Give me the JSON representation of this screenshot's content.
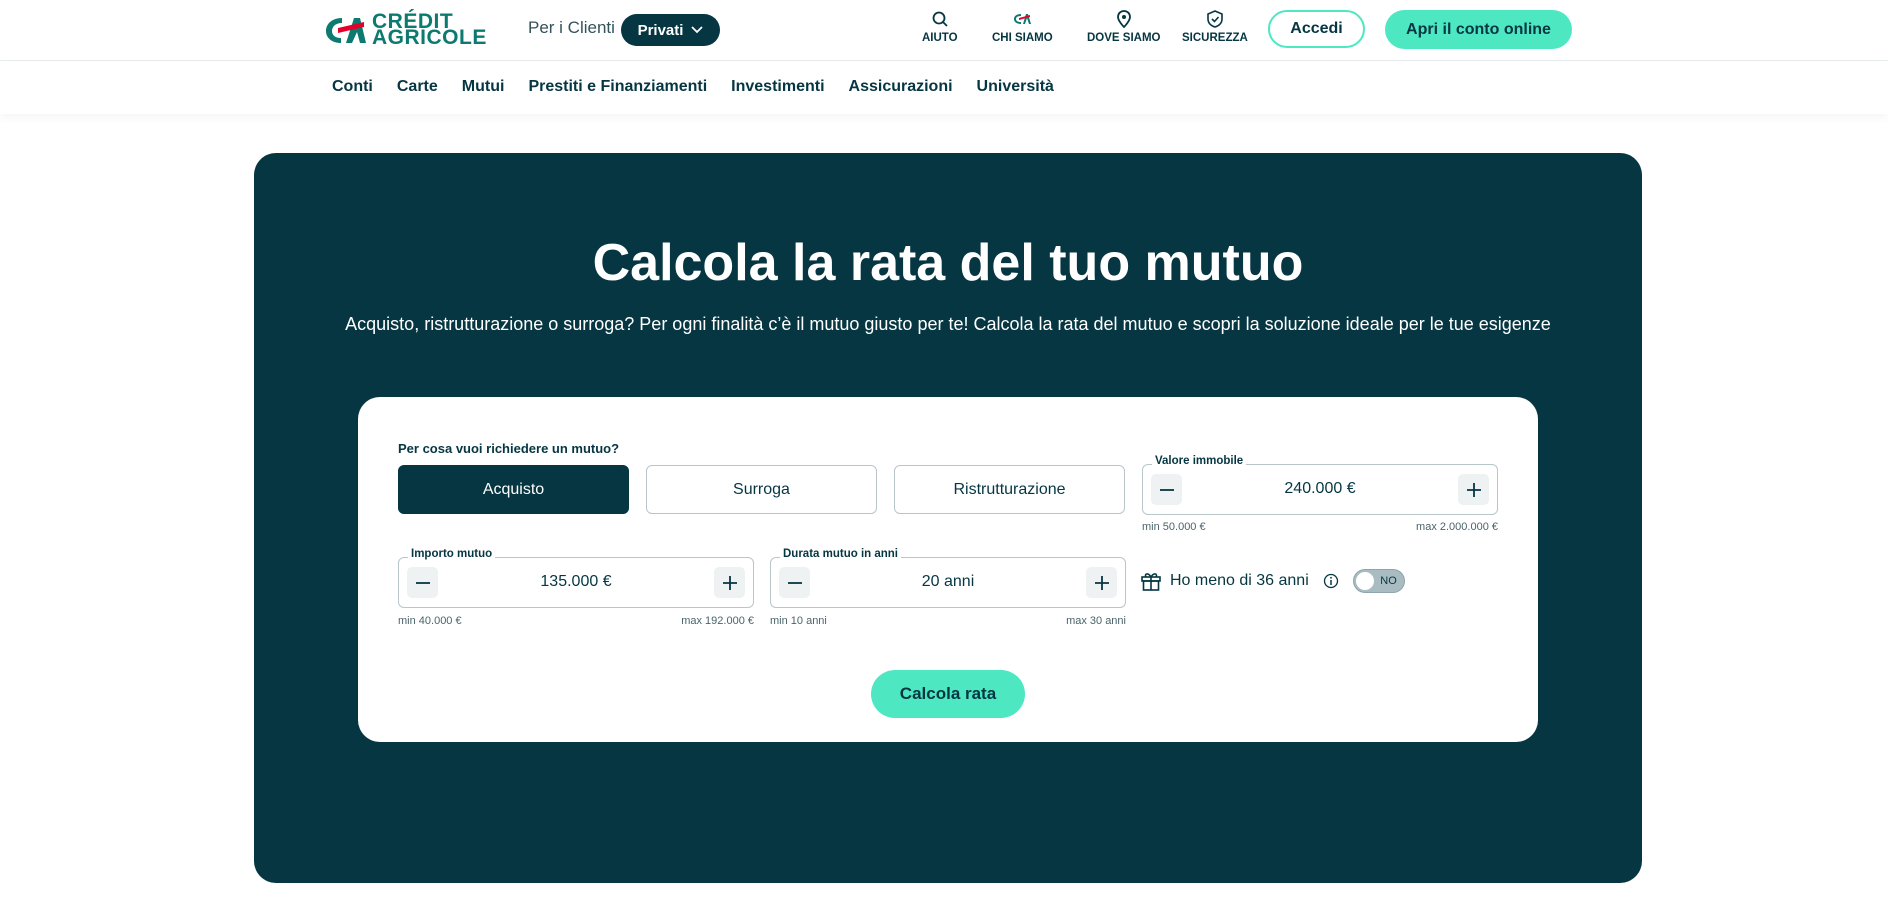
{
  "header": {
    "logo_line1": "CRÉDIT",
    "logo_line2": "AGRICOLE",
    "per_clienti": "Per i Clienti",
    "privati": "Privati",
    "utilities": [
      {
        "label": "AIUTO",
        "icon": "search-icon"
      },
      {
        "label": "CHI SIAMO",
        "icon": "ca-logo-icon"
      },
      {
        "label": "DOVE SIAMO",
        "icon": "location-pin-icon"
      },
      {
        "label": "SICUREZZA",
        "icon": "shield-icon"
      }
    ],
    "accedi": "Accedi",
    "apri": "Apri il conto online"
  },
  "menu": {
    "items": [
      "Conti",
      "Carte",
      "Mutui",
      "Prestiti e Finanziamenti",
      "Investimenti",
      "Assicurazioni",
      "Università"
    ]
  },
  "hero": {
    "title": "Calcola la rata del tuo mutuo",
    "subtitle": "Acquisto, ristrutturazione o surroga? Per ogni finalità c’è il mutuo giusto per te! Calcola la rata del mutuo e scopri la soluzione ideale per le tue esigenze"
  },
  "calculator": {
    "question": "Per cosa vuoi richiedere un mutuo?",
    "options": [
      {
        "label": "Acquisto",
        "active": true
      },
      {
        "label": "Surroga",
        "active": false
      },
      {
        "label": "Ristrutturazione",
        "active": false
      }
    ],
    "valore_immobile": {
      "label": "Valore immobile",
      "value": "240.000 €",
      "min": "min 50.000 €",
      "max": "max 2.000.000 €"
    },
    "importo_mutuo": {
      "label": "Importo mutuo",
      "value": "135.000 €",
      "min": "min 40.000 €",
      "max": "max 192.000 €"
    },
    "durata": {
      "label": "Durata mutuo in anni",
      "value": "20 anni",
      "min": "min 10 anni",
      "max": "max 30 anni"
    },
    "under36": {
      "label": "Ho meno di 36 anni",
      "toggle": "NO"
    },
    "submit": "Calcola rata"
  },
  "colors": {
    "brand_dark": "#053642",
    "accent": "#4de8c2",
    "logo_green": "#0c7a6f",
    "logo_red": "#e4002b"
  }
}
